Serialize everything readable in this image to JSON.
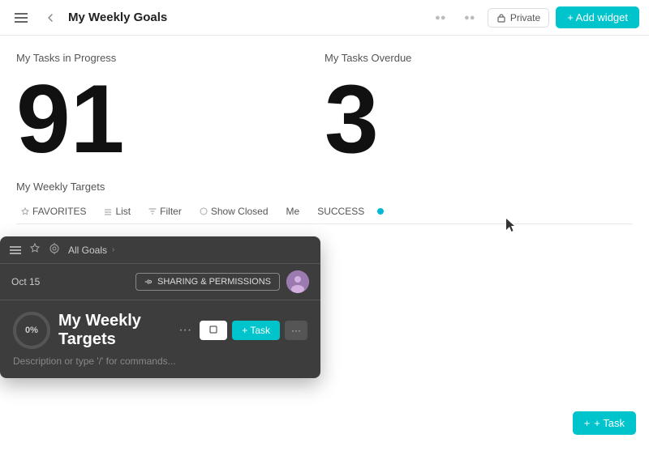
{
  "header": {
    "title": "My Weekly Goals",
    "private_label": "Private",
    "add_widget_label": "+ Add widget"
  },
  "stats": {
    "in_progress_label": "My Tasks in Progress",
    "in_progress_count": "91",
    "overdue_label": "My Tasks Overdue",
    "overdue_count": "3"
  },
  "weekly_targets": {
    "title": "My Weekly Targets",
    "filters": {
      "favorites": "FAVORITES",
      "list": "List",
      "filter": "Filter",
      "show_closed": "Show Closed",
      "me": "Me",
      "success": "SUCCESS"
    }
  },
  "overlay": {
    "breadcrumb": {
      "home": "All Goals",
      "separator": "›"
    },
    "date": "Oct 15",
    "sharing_label": "SHARING & PERMISSIONS",
    "title": "My Weekly Targets",
    "progress": "0%",
    "description": "Description or type '/' for commands...",
    "white_btn": "",
    "task_btn": "+ Task",
    "more_btn": "..."
  },
  "add_task_btn": "+ Task",
  "icons": {
    "hamburger": "☰",
    "back": "←",
    "lock": "🔒",
    "share_icon": "⟨"
  }
}
